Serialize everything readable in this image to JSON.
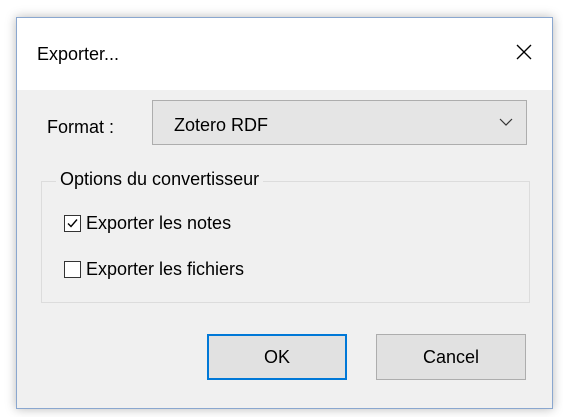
{
  "dialog": {
    "title": "Exporter...",
    "close_icon": "close-icon"
  },
  "format": {
    "label": "Format :",
    "selected_value": "Zotero RDF",
    "arrow_icon": "chevron-down-icon"
  },
  "options": {
    "group_title": "Options du convertisseur",
    "items": [
      {
        "label": "Exporter les notes",
        "checked": true
      },
      {
        "label": "Exporter les fichiers",
        "checked": false
      }
    ]
  },
  "buttons": {
    "ok_label": "OK",
    "cancel_label": "Cancel"
  },
  "colors": {
    "window_border": "#8aa7cf",
    "dialog_background": "#f0f0f0",
    "default_button_border": "#0078d7"
  }
}
